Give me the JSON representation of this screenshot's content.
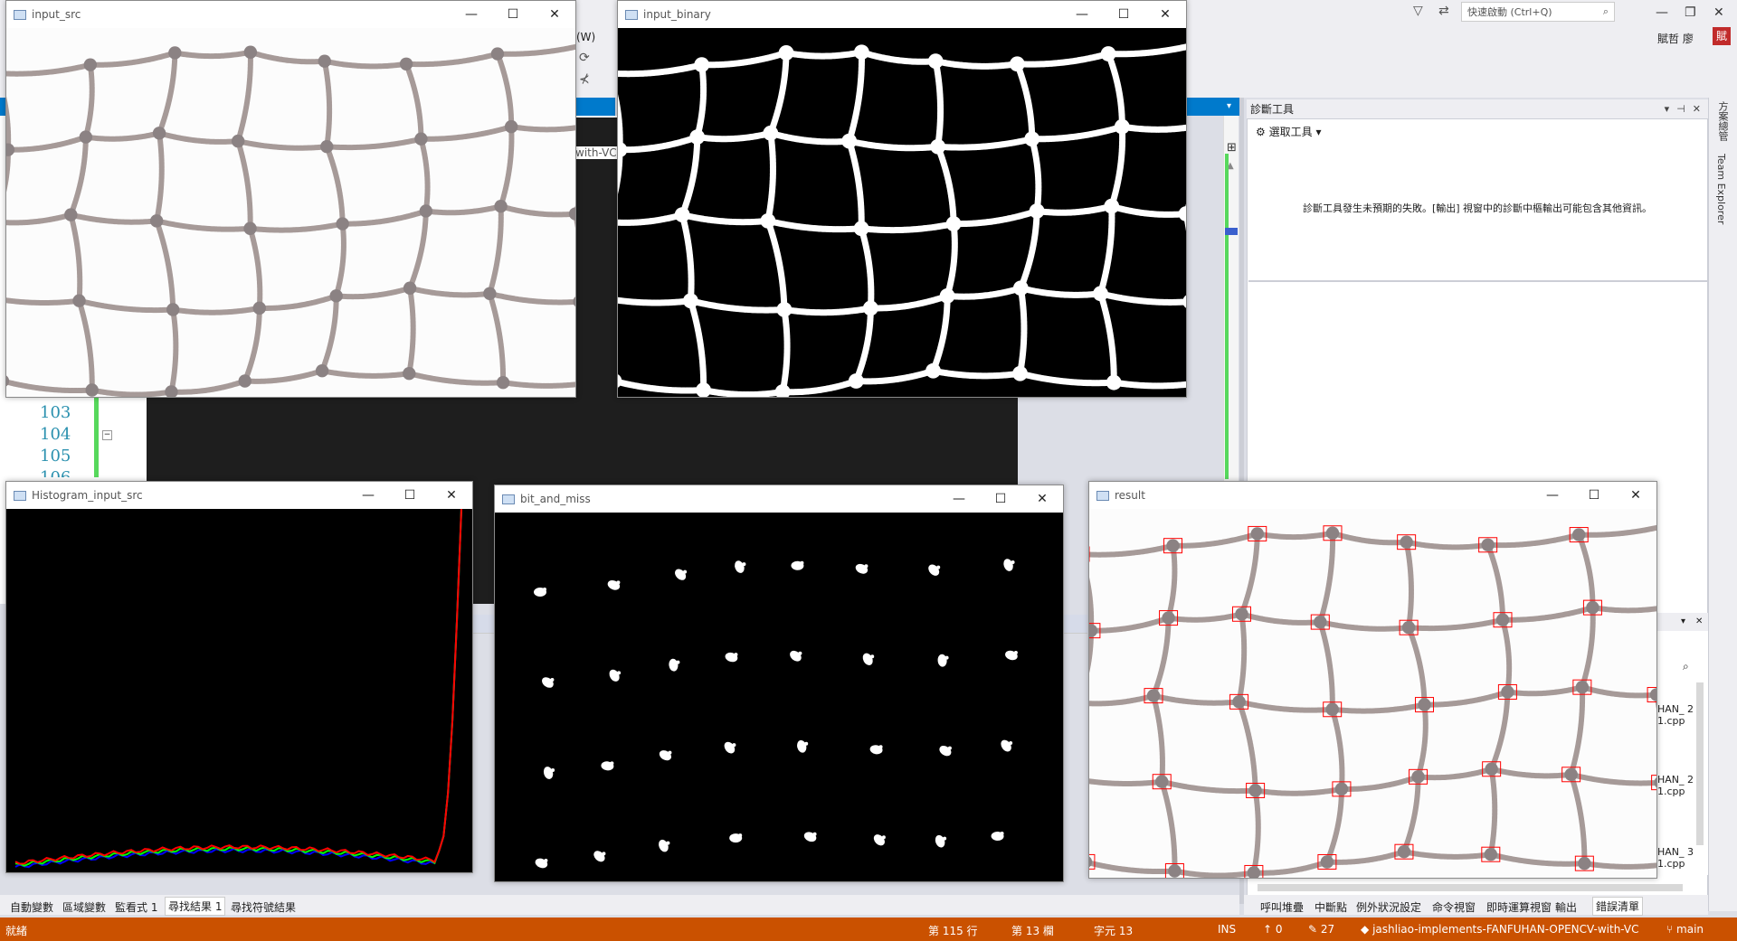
{
  "vs": {
    "menu_partial": "(W)",
    "quick_launch_placeholder": "快速啟動 (Ctrl+Q)",
    "user_name": "賦哲 廖",
    "user_initial": "賦",
    "editor_partial_tab": "with-VC",
    "line_numbers": [
      "103",
      "104",
      "105",
      "106"
    ],
    "diagnostics": {
      "title": "診斷工具",
      "select_tool": "選取工具",
      "message": "診斷工具發生未預期的失敗。[輸出] 視窗中的診斷中樞輸出可能包含其他資訊。"
    },
    "side_tabs": [
      "方案總管",
      "Team Explorer"
    ],
    "lower_right_items": [
      {
        "line1": "HAN_ 2",
        "line2": "1.cpp"
      },
      {
        "line1": "HAN_ 2",
        "line2": "1.cpp"
      },
      {
        "line1": "HAN_ 3",
        "line2": "1.cpp"
      }
    ],
    "bottom_tabs_left": [
      {
        "label": "自動變數",
        "active": false
      },
      {
        "label": "區域變數",
        "active": false
      },
      {
        "label": "監看式 1",
        "active": false
      },
      {
        "label": "尋找結果 1",
        "active": true
      },
      {
        "label": "尋找符號結果",
        "active": false
      }
    ],
    "bottom_tabs_right": [
      {
        "label": "呼叫堆疊",
        "active": false
      },
      {
        "label": "中斷點",
        "active": false
      },
      {
        "label": "例外狀況設定",
        "active": false
      },
      {
        "label": "命令視窗",
        "active": false
      },
      {
        "label": "即時運算視窗",
        "active": false
      },
      {
        "label": "輸出",
        "active": false
      },
      {
        "label": "錯誤清單",
        "active": true
      }
    ],
    "status": {
      "ready": "就緒",
      "line": "第 115 行",
      "col": "第 13 欄",
      "char": "字元 13",
      "ins": "INS",
      "up_count": "0",
      "edit_count": "27",
      "repo": "jashliao-implements-FANFUHAN-OPENCV-with-VC",
      "branch": "main"
    }
  },
  "windows": {
    "input_src": {
      "title": "input_src"
    },
    "input_binary": {
      "title": "input_binary"
    },
    "histogram": {
      "title": "Histogram_input_src"
    },
    "bit_and_miss": {
      "title": "bit_and_miss"
    },
    "result": {
      "title": "result"
    }
  },
  "window_controls": {
    "minimize": "—",
    "maximize": "☐",
    "close": "✕"
  },
  "histogram": {
    "series": [
      {
        "name": "blue",
        "color": "#0000ff"
      },
      {
        "name": "green",
        "color": "#00ff00"
      },
      {
        "name": "red",
        "color": "#ff0000"
      }
    ]
  },
  "colors": {
    "vs_accent": "#007acc",
    "status_bar": "#ca5100",
    "rope": "#a69a98",
    "marker": "#ff0000"
  }
}
